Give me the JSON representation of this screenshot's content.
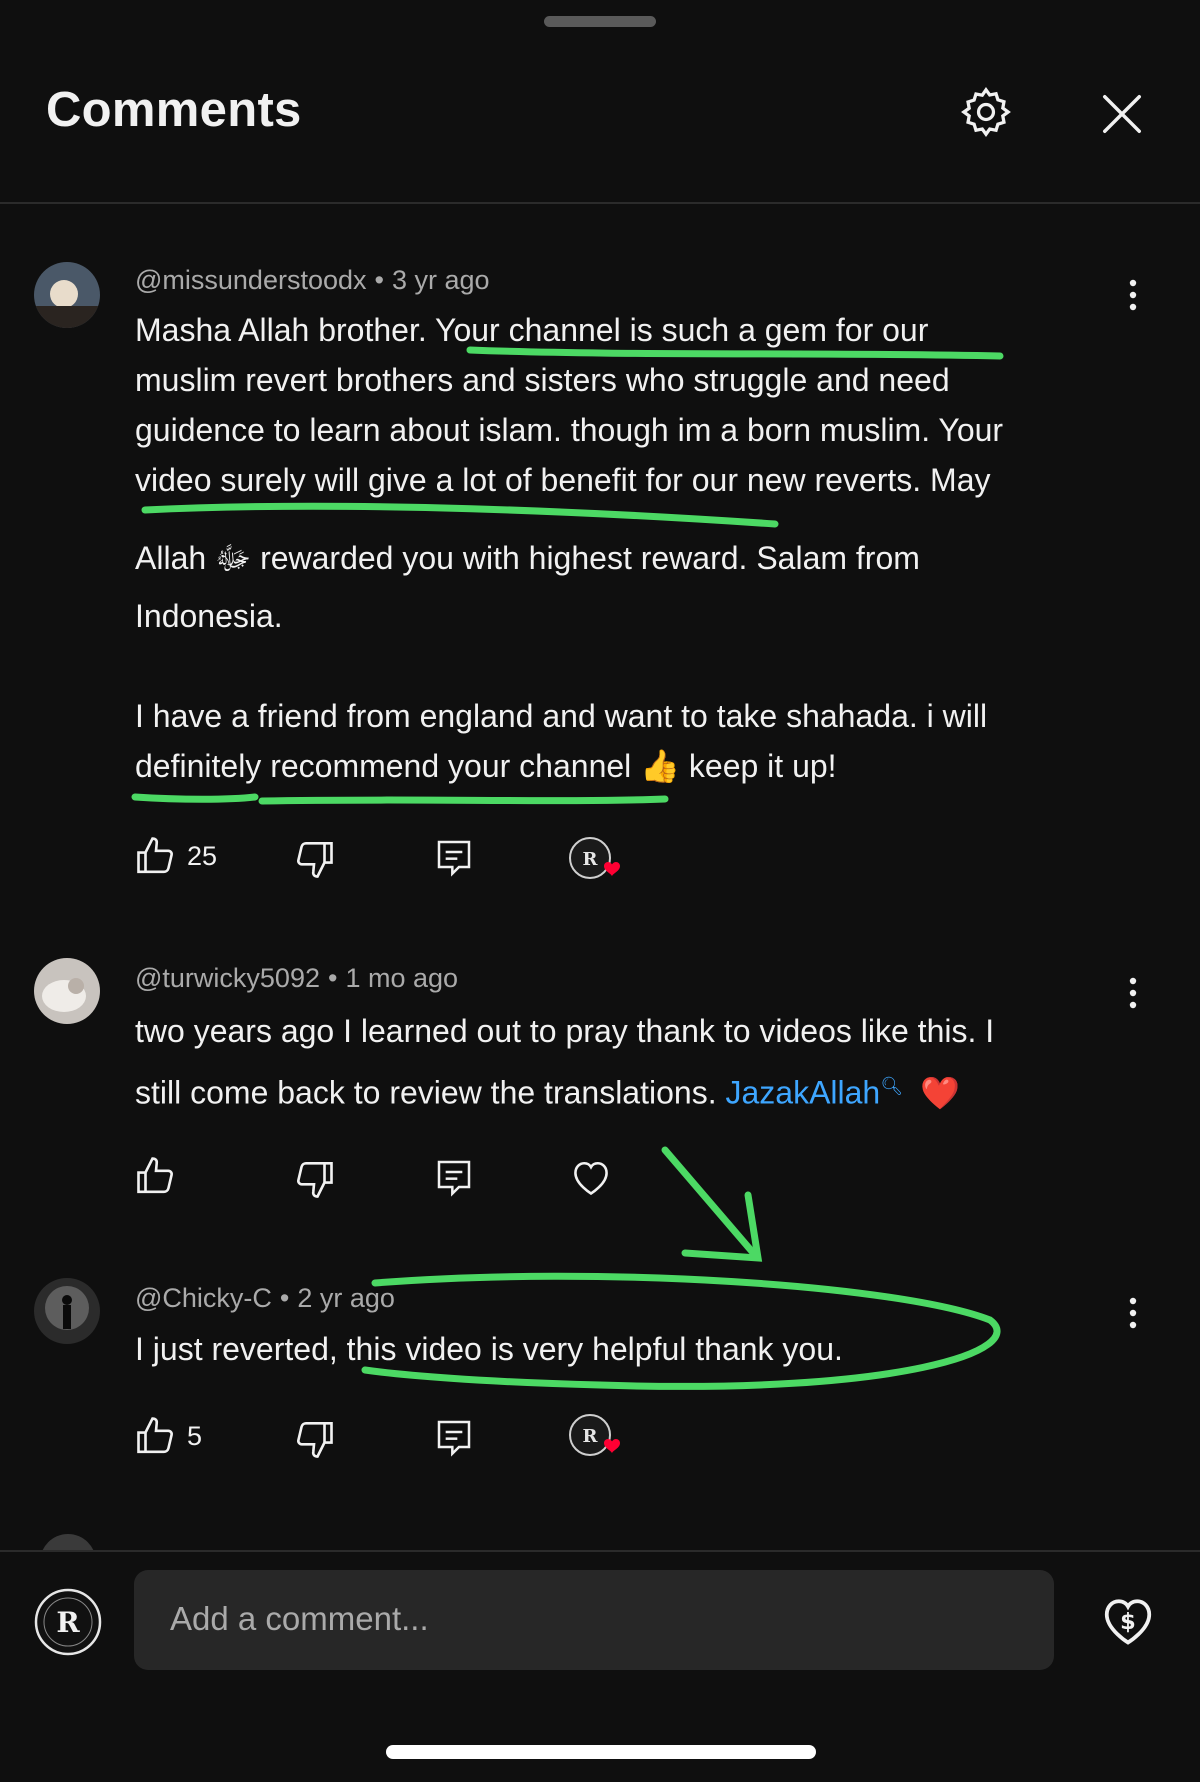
{
  "header": {
    "title": "Comments"
  },
  "comments": [
    {
      "author": "@missunderstoodx",
      "time": "3 yr ago",
      "text_lines": [
        "Masha Allah brother. Your channel is such a gem for our",
        "muslim revert brothers and sisters who struggle and need",
        "guidence to learn about islam. though im a born muslim. Your",
        "video surely will give a lot of benefit for our new reverts. May",
        "Allah ﷻ rewarded you with highest reward. Salam from",
        "Indonesia.",
        "I have a friend from england and want to take shahada. i will",
        "definitely recommend your channel 👍 keep it up!"
      ],
      "likes": "25",
      "creator_hearted": true
    },
    {
      "author": "@turwicky5092",
      "time": "1 mo ago",
      "text_lines": [
        "two years ago I learned out to pray thank to videos like this. I",
        "still come back to review the translations."
      ],
      "link_text": "JazakAllah",
      "emoji": "❤️",
      "likes": "",
      "creator_hearted": false
    },
    {
      "author": "@Chicky-C",
      "time": "2 yr ago",
      "text_lines": [
        "I just reverted, this video is very helpful thank you."
      ],
      "likes": "5",
      "creator_hearted": true
    }
  ],
  "composer": {
    "placeholder": "Add a comment..."
  },
  "colors": {
    "background": "#0f0f0f",
    "text": "#f1f1f1",
    "muted": "#aaaaaa",
    "link": "#3ea6ff",
    "highlight_marker": "#4cd964",
    "heart": "#ff0033"
  },
  "icons": [
    "gear-icon",
    "close-icon",
    "kebab-icon",
    "thumb-up-icon",
    "thumb-down-icon",
    "reply-icon",
    "heart-icon",
    "super-thanks-icon"
  ]
}
